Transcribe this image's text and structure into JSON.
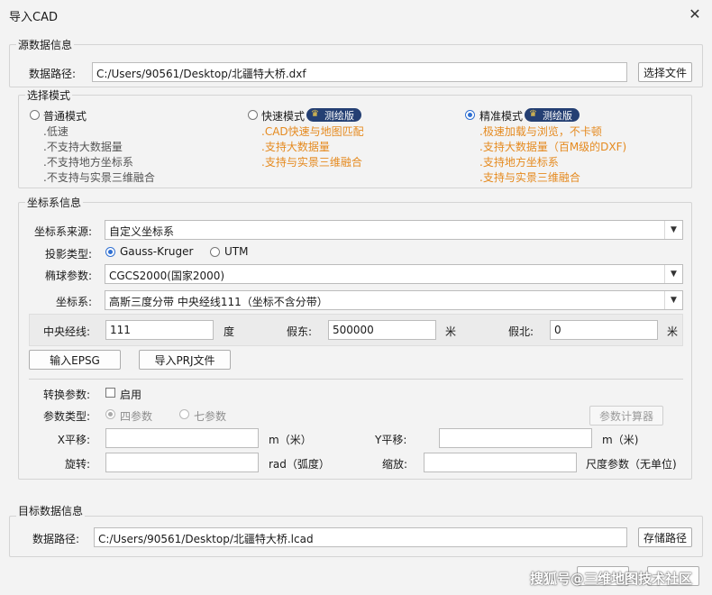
{
  "window": {
    "title": "导入CAD"
  },
  "source": {
    "group_title": "源数据信息",
    "path_label": "数据路径:",
    "path_value": "C:/Users/90561/Desktop/北疆特大桥.dxf",
    "select_file_button": "选择文件"
  },
  "mode": {
    "group_title": "选择模式",
    "options": [
      {
        "label": "普通模式",
        "selected": false,
        "badge": "",
        "features": [
          ".低速",
          ".不支持大数据量",
          ".不支持地方坐标系",
          ".不支持与实景三维融合"
        ],
        "feature_color": "grey"
      },
      {
        "label": "快速模式",
        "selected": false,
        "badge": "测绘版",
        "features": [
          ".CAD快速与地图匹配",
          ".支持大数据量",
          ".支持与实景三维融合"
        ],
        "feature_color": "orange"
      },
      {
        "label": "精准模式",
        "selected": true,
        "badge": "测绘版",
        "features": [
          ".极速加载与浏览，不卡顿",
          ".支持大数据量（百M级的DXF)",
          ".支持地方坐标系",
          ".支持与实景三维融合"
        ],
        "feature_color": "orange"
      }
    ]
  },
  "crs": {
    "group_title": "坐标系信息",
    "source_label": "坐标系来源:",
    "source_value": "自定义坐标系",
    "projection_label": "投影类型:",
    "projection_options": [
      {
        "label": "Gauss-Kruger",
        "selected": true
      },
      {
        "label": "UTM",
        "selected": false
      }
    ],
    "ellipsoid_label": "椭球参数:",
    "ellipsoid_value": "CGCS2000(国家2000)",
    "crs_label": "坐标系:",
    "crs_value": "高斯三度分带 中央经线111（坐标不含分带）",
    "central_meridian_label": "中央经线:",
    "central_meridian_value": "111",
    "central_meridian_unit": "度",
    "false_east_label": "假东:",
    "false_east_value": "500000",
    "false_east_unit": "米",
    "false_north_label": "假北:",
    "false_north_value": "0",
    "false_north_unit": "米",
    "input_epsg_button": "输入EPSG",
    "import_prj_button": "导入PRJ文件",
    "transform_label": "转换参数:",
    "transform_enable_label": "启用",
    "transform_enabled": false,
    "param_type_label": "参数类型:",
    "param_type_options": [
      {
        "label": "四参数",
        "selected": true
      },
      {
        "label": "七参数",
        "selected": false
      }
    ],
    "param_calc_button": "参数计算器",
    "x_shift_label": "X平移:",
    "x_shift_value": "",
    "x_shift_unit": "m（米）",
    "y_shift_label": "Y平移:",
    "y_shift_value": "",
    "y_shift_unit": "m（米)",
    "rotation_label": "旋转:",
    "rotation_value": "",
    "rotation_unit": "rad（弧度）",
    "scale_label": "缩放:",
    "scale_value": "",
    "scale_unit": "尺度参数（无单位)"
  },
  "target": {
    "group_title": "目标数据信息",
    "path_label": "数据路径:",
    "path_value": "C:/Users/90561/Desktop/北疆特大桥.lcad",
    "save_path_button": "存储路径"
  },
  "footer": {
    "watermark": "搜狐号@三维地图技术社区"
  }
}
